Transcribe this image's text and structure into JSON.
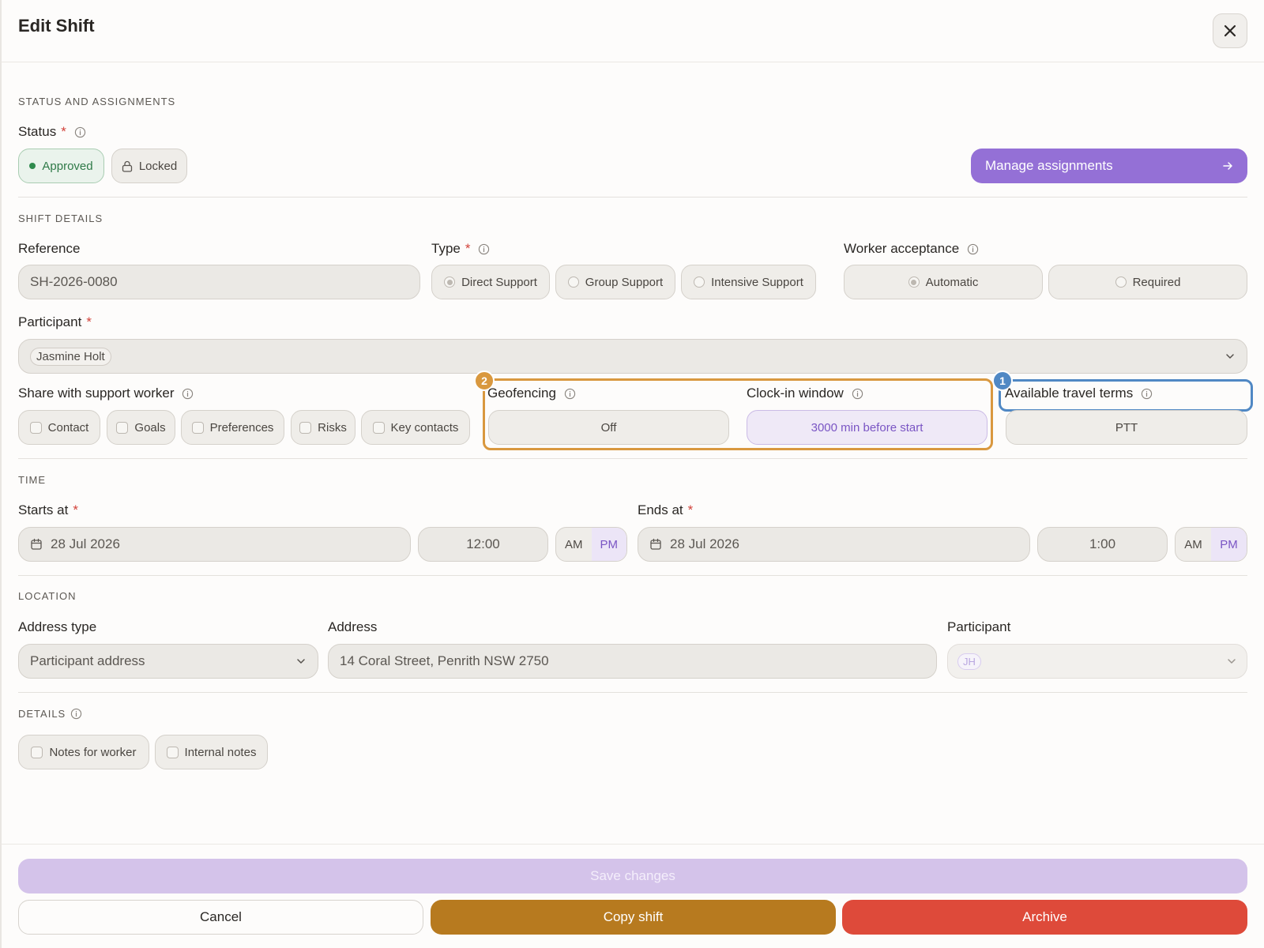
{
  "dialog": {
    "title": "Edit Shift"
  },
  "status_section": {
    "heading": "STATUS AND ASSIGNMENTS",
    "status_label": "Status",
    "approved_label": "Approved",
    "locked_label": "Locked",
    "manage_label": "Manage assignments"
  },
  "shift_details": {
    "heading": "SHIFT DETAILS",
    "reference_label": "Reference",
    "reference_value": "SH-2026-0080",
    "type_label": "Type",
    "type_options": [
      "Direct Support",
      "Group Support",
      "Intensive Support"
    ],
    "type_selected": "Direct Support",
    "acceptance_label": "Worker acceptance",
    "acceptance_options": [
      "Automatic",
      "Required"
    ],
    "acceptance_selected": "Automatic",
    "participant_label": "Participant",
    "participant_value": "Jasmine Holt",
    "share_label": "Share with support worker",
    "share_options": [
      "Contact",
      "Goals",
      "Preferences",
      "Risks",
      "Key contacts"
    ],
    "geofencing_label": "Geofencing",
    "geofencing_value": "Off",
    "clockin_label": "Clock-in window",
    "clockin_value": "3000 min before start",
    "travel_label": "Available travel terms",
    "travel_value": "PTT",
    "badges": {
      "orange": "2",
      "blue": "1"
    }
  },
  "time": {
    "heading": "TIME",
    "starts_label": "Starts at",
    "starts_date": "28 Jul 2026",
    "starts_time": "12:00",
    "ends_label": "Ends at",
    "ends_date": "28 Jul 2026",
    "ends_time": "1:00",
    "am": "AM",
    "pm": "PM",
    "starts_period": "PM",
    "ends_period": "PM"
  },
  "location": {
    "heading": "LOCATION",
    "address_type_label": "Address type",
    "address_type_value": "Participant address",
    "address_label": "Address",
    "address_value": "14 Coral Street, Penrith NSW 2750",
    "participant_label": "Participant",
    "participant_initials": "JH"
  },
  "details": {
    "heading": "DETAILS",
    "options": [
      "Notes for worker",
      "Internal notes"
    ]
  },
  "footer": {
    "save_label": "Save changes",
    "cancel_label": "Cancel",
    "copy_label": "Copy shift",
    "archive_label": "Archive"
  },
  "colors": {
    "accent": "#9470d6",
    "copy": "#b77a1f",
    "archive": "#de4a3a",
    "save_disabled": "#d4c3ea",
    "highlight_orange": "#d9983f",
    "highlight_blue": "#5088c4"
  },
  "icons": [
    "close-icon",
    "info-icon",
    "lock-icon",
    "arrow-right-icon",
    "chevron-down-icon",
    "calendar-icon"
  ]
}
